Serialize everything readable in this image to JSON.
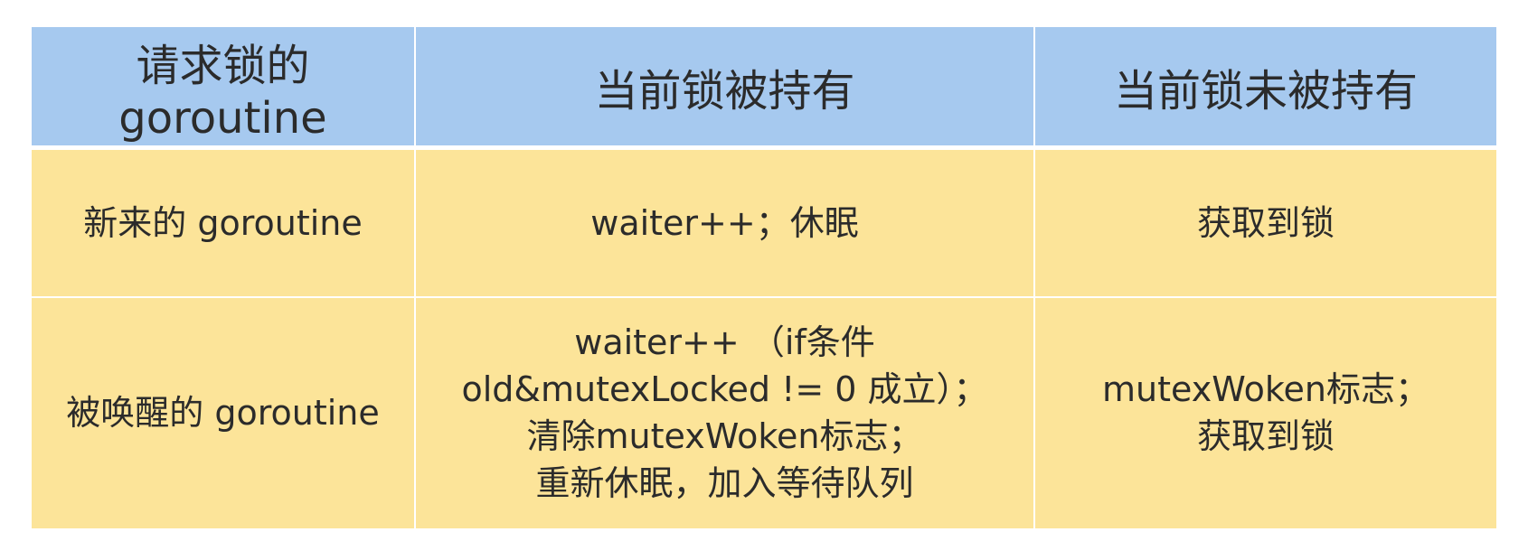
{
  "table": {
    "headers": [
      "请求锁的goroutine",
      "当前锁被持有",
      "当前锁未被持有"
    ],
    "rows": [
      {
        "requester": "新来的 goroutine",
        "held": [
          "waiter++；休眠"
        ],
        "not_held": [
          "获取到锁"
        ]
      },
      {
        "requester": "被唤醒的 goroutine",
        "held": [
          "waiter++ （if条件",
          "old&mutexLocked != 0 成立）；",
          "清除mutexWoken标志；",
          "重新休眠，加入等待队列"
        ],
        "not_held": [
          "mutexWoken标志；",
          "获取到锁"
        ]
      }
    ]
  },
  "colors": {
    "header_bg": "#a6c9ef",
    "body_bg": "#fce499",
    "text": "#2b2b2b"
  }
}
